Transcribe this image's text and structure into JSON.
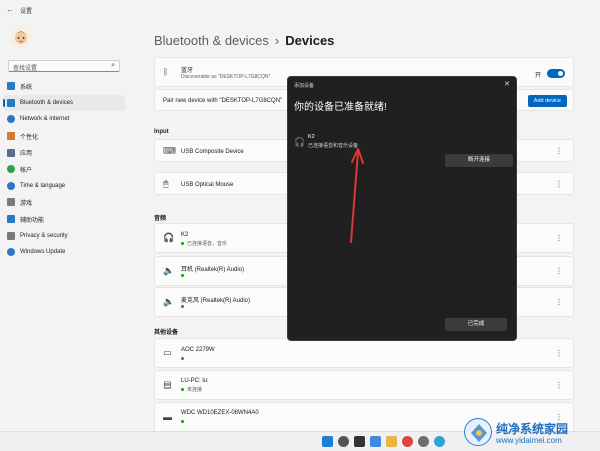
{
  "window": {
    "title": "设置"
  },
  "sidebar": {
    "search_placeholder": "查找设置",
    "items": [
      {
        "label": "系统",
        "icon": "monitor-icon",
        "color": "#2b79c2"
      },
      {
        "label": "Bluetooth & devices",
        "icon": "bluetooth-icon",
        "color": "#2b79c2",
        "active": true
      },
      {
        "label": "Network & internet",
        "icon": "network-icon",
        "color": "#2b79c2"
      },
      {
        "label": "个性化",
        "icon": "brush-icon",
        "color": "#d27b2f"
      },
      {
        "label": "应用",
        "icon": "apps-icon",
        "color": "#5a6e8c"
      },
      {
        "label": "帐户",
        "icon": "account-icon",
        "color": "#2ea04a"
      },
      {
        "label": "Time & language",
        "icon": "globe-clock-icon",
        "color": "#2b79c2"
      },
      {
        "label": "游戏",
        "icon": "gamepad-icon",
        "color": "#7a7a7a"
      },
      {
        "label": "辅助功能",
        "icon": "accessibility-icon",
        "color": "#2b79c2"
      },
      {
        "label": "Privacy & security",
        "icon": "shield-icon",
        "color": "#7a7a7a"
      },
      {
        "label": "Windows Update",
        "icon": "update-icon",
        "color": "#2b79c2"
      }
    ]
  },
  "main": {
    "breadcrumb": {
      "parent": "Bluetooth & devices",
      "current": "Devices"
    },
    "bluetooth": {
      "title": "蓝牙",
      "subtitle": "Discoverable as \"DESKTOP-L7G8CQN\"",
      "toggle_label": "开"
    },
    "pair": {
      "text": "Pair new device with \"DESKTOP-L7G8CQN\"",
      "button": "Add device"
    },
    "sections": {
      "input": "Input",
      "audio": "音频",
      "other": "其他设备"
    },
    "input_devices": [
      {
        "name": "USB Composite Device",
        "icon": "keyboard-icon"
      },
      {
        "name": "USB Optical Mouse",
        "icon": "mouse-icon"
      }
    ],
    "audio_devices": [
      {
        "name": "K2",
        "status": "已连接语音，音乐",
        "icon": "headphones-icon"
      },
      {
        "name": "耳机 (Realtek(R) Audio)",
        "icon": "speaker-icon"
      },
      {
        "name": "麦克风 (Realtek(R) Audio)",
        "icon": "speaker-icon"
      }
    ],
    "other_devices": [
      {
        "name": "AOC 2279W",
        "icon": "display-icon"
      },
      {
        "name": "LU-PC: lu:",
        "status": "未连接",
        "icon": "device-icon"
      },
      {
        "name": "WDC WD10EZEX-08WN4A0",
        "icon": "drive-icon"
      }
    ]
  },
  "dialog": {
    "caption": "添加设备",
    "heading": "你的设备已准备就绪!",
    "device_name": "K2",
    "device_status": "已连接语音和音乐设备",
    "disconnect_button": "断开连接",
    "done_button": "已完成"
  },
  "watermark": {
    "line1": "纯净系统家园",
    "line2": "www.yidaimei.com"
  },
  "colors": {
    "accent": "#0067c0",
    "connected": "#13a10e",
    "annotation_arrow": "#d93a32"
  }
}
